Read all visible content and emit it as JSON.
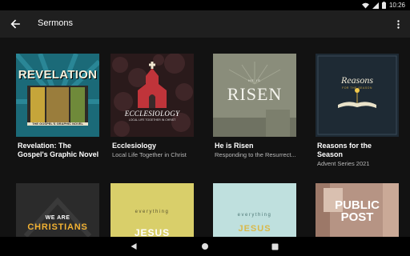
{
  "status_bar": {
    "time": "10:26"
  },
  "app_bar": {
    "title": "Sermons"
  },
  "cards": [
    {
      "title": "Revelation: The Gospel's Graphic Novel",
      "subtitle": "",
      "art_title": "REVELATION",
      "art_sub": "THE GOSPEL'S GRAPHIC NOVEL"
    },
    {
      "title": "Ecclesiology",
      "subtitle": "Local Life Together in Christ",
      "art_title": "ECCLESIOLOGY",
      "art_sub": "LOCAL LIFE TOGETHER IN CHRIST"
    },
    {
      "title": "He is Risen",
      "subtitle": "Responding to the Resurrect...",
      "art_title": "RISEN",
      "art_sub": "HE IS"
    },
    {
      "title": "Reasons for the Season",
      "subtitle": "Advent Series 2021",
      "art_title": "Reasons",
      "art_sub": "FOR THE SEASON"
    },
    {
      "title": "",
      "subtitle": "",
      "art_title": "CHRISTIANS",
      "art_sub": "WE ARE"
    },
    {
      "title": "",
      "subtitle": "",
      "art_title": "JESUS",
      "art_sub": "everything"
    },
    {
      "title": "",
      "subtitle": "",
      "art_title": "JESUS",
      "art_sub": "everything"
    },
    {
      "title": "",
      "subtitle": "",
      "art_title": "PUBLIC POST",
      "art_sub": ""
    }
  ],
  "icons": {
    "back": "arrow-back-icon",
    "overflow": "more-vert-icon",
    "wifi": "wifi-icon",
    "signal": "cell-signal-icon",
    "battery": "battery-icon",
    "nav_back": "nav-back-icon",
    "nav_home": "nav-home-icon",
    "nav_recents": "nav-recents-icon"
  },
  "colors": {
    "app_bar": "#1f1f1f",
    "background": "#121212",
    "subtitle": "#b9b9b9"
  }
}
